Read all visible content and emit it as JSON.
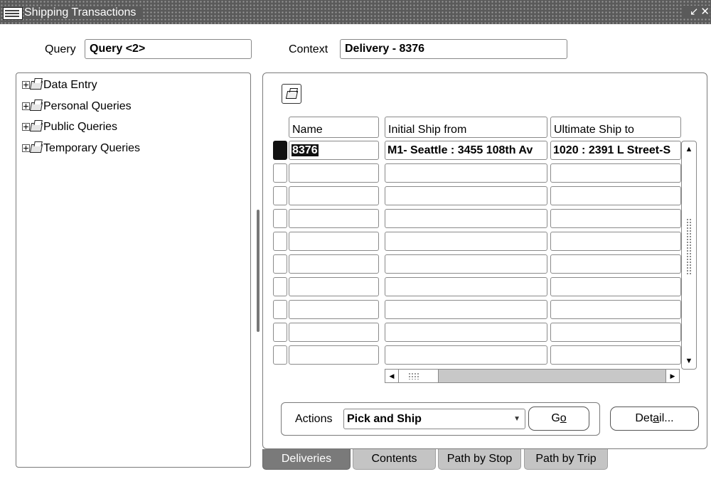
{
  "window": {
    "title": "Shipping Transactions",
    "controls": [
      "↙",
      "✕"
    ]
  },
  "query": {
    "label": "Query",
    "value": "Query <2>"
  },
  "context": {
    "label": "Context",
    "value": "Delivery - 8376"
  },
  "tree": {
    "items": [
      {
        "label": "Data Entry"
      },
      {
        "label": "Personal Queries"
      },
      {
        "label": "Public Queries"
      },
      {
        "label": "Temporary Queries"
      }
    ]
  },
  "grid": {
    "columns": [
      "Name",
      "Initial Ship from",
      "Ultimate Ship to"
    ],
    "rows": [
      {
        "name": "8376",
        "ship_from": "M1- Seattle : 3455 108th Av",
        "ship_to": "1020 : 2391 L Street-S"
      },
      {
        "name": "",
        "ship_from": "",
        "ship_to": ""
      },
      {
        "name": "",
        "ship_from": "",
        "ship_to": ""
      },
      {
        "name": "",
        "ship_from": "",
        "ship_to": ""
      },
      {
        "name": "",
        "ship_from": "",
        "ship_to": ""
      },
      {
        "name": "",
        "ship_from": "",
        "ship_to": ""
      },
      {
        "name": "",
        "ship_from": "",
        "ship_to": ""
      },
      {
        "name": "",
        "ship_from": "",
        "ship_to": ""
      },
      {
        "name": "",
        "ship_from": "",
        "ship_to": ""
      },
      {
        "name": "",
        "ship_from": "",
        "ship_to": ""
      }
    ]
  },
  "actions": {
    "label": "Actions",
    "selected": "Pick and Ship",
    "go_prefix": "G",
    "go_mnemonic": "o",
    "detail_prefix": "Det",
    "detail_mnemonic": "a",
    "detail_suffix": "il..."
  },
  "tabs": [
    {
      "label": "Deliveries",
      "active": true
    },
    {
      "label": "Contents",
      "active": false
    },
    {
      "label": "Path by Stop",
      "active": false
    },
    {
      "label": "Path by Trip",
      "active": false
    }
  ]
}
